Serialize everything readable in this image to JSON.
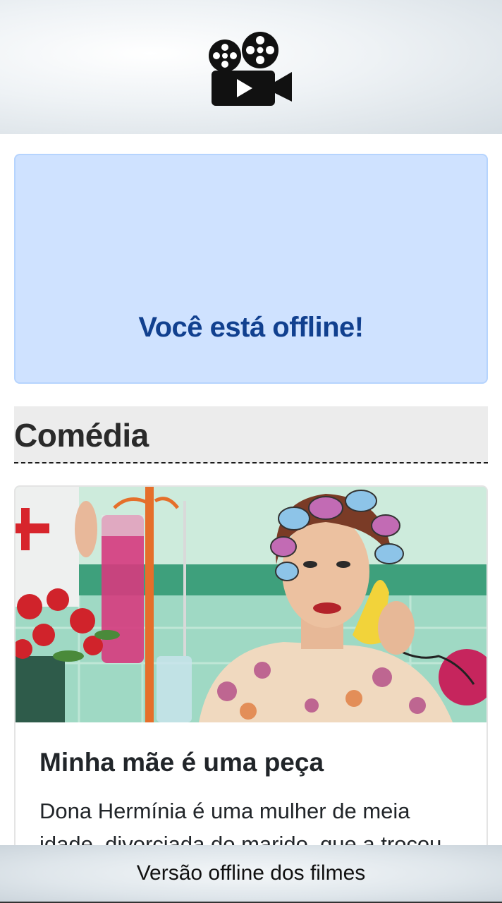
{
  "header": {
    "logo_icon": "movie-camera-icon"
  },
  "offline_alert": {
    "icon": "wifi-off-icon",
    "message": "Você está offline!",
    "background": "#cfe2ff",
    "text_color": "#11408f"
  },
  "section": {
    "title": "Comédia"
  },
  "movies": [
    {
      "title": "Minha mãe é uma peça",
      "description": "Dona Hermínia é uma mulher de meia idade, divorciada do marido, que a trocou"
    }
  ],
  "footer": {
    "text": "Versão offline dos filmes"
  }
}
